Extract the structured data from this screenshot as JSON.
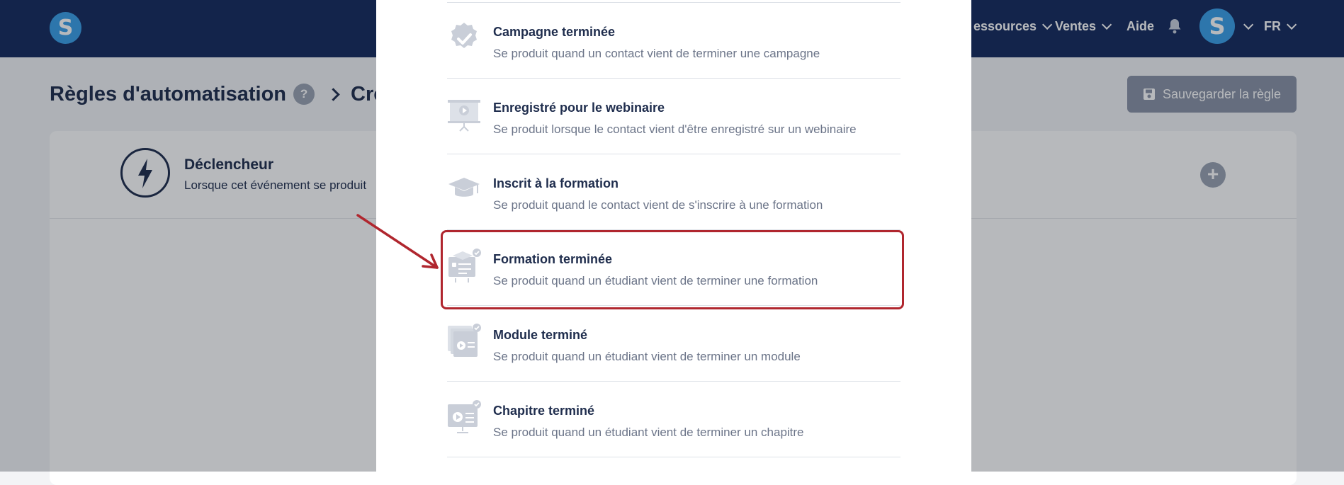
{
  "app": {
    "logo_letter": "S",
    "nav": {
      "resources_label": "essources",
      "sales_label": "Ventes",
      "help_label": "Aide",
      "avatar_letter": "S",
      "language_label": "FR"
    }
  },
  "page": {
    "breadcrumb_root": "Règles d'automatisation",
    "help_badge": "?",
    "breadcrumb_current": "Crée",
    "save_button_label": "Sauvegarder la règle"
  },
  "trigger": {
    "title": "Déclencheur",
    "subtitle": "Lorsque cet événement se produit"
  },
  "modal": {
    "events": [
      {
        "icon": "badge-check-icon",
        "title": "Campagne terminée",
        "description": "Se produit quand un contact vient de terminer une campagne"
      },
      {
        "icon": "webinar-board-icon",
        "title": "Enregistré pour le webinaire",
        "description": "Se produit lorsque le contact vient d'être enregistré sur un webinaire"
      },
      {
        "icon": "graduation-cap-icon",
        "title": "Inscrit à la formation",
        "description": "Se produit quand le contact vient de s'inscrire à une formation"
      },
      {
        "icon": "course-completed-icon",
        "title": "Formation terminée",
        "description": "Se produit quand un étudiant vient de terminer une formation"
      },
      {
        "icon": "module-completed-icon",
        "title": "Module terminé",
        "description": "Se produit quand un étudiant vient de terminer un module"
      },
      {
        "icon": "chapter-completed-icon",
        "title": "Chapitre terminé",
        "description": "Se produit quand un étudiant vient de terminer un chapitre"
      }
    ],
    "highlighted_event": "Formation terminée"
  },
  "colors": {
    "topbar": "#152a5e",
    "brand_blue": "#3aa0e8",
    "annotation_red": "#b0262e",
    "icon_gray": "#c9ced8"
  }
}
